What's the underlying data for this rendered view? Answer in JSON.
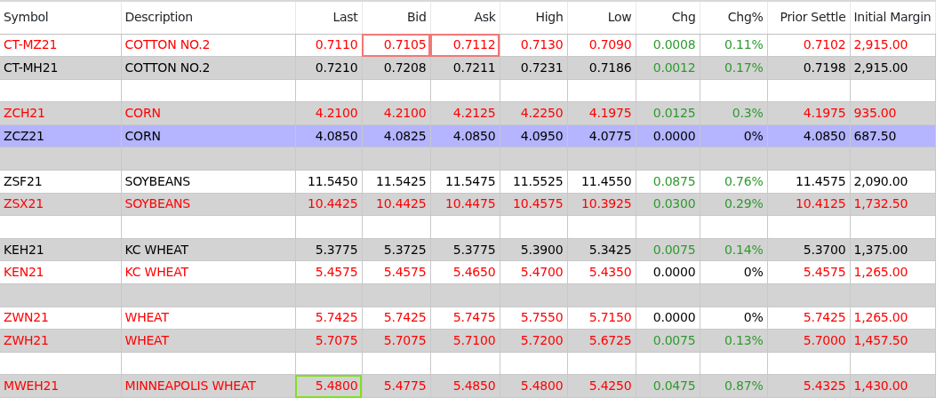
{
  "table": {
    "columns": [
      "Symbol",
      "Description",
      "Last",
      "Bid",
      "Ask",
      "High",
      "Low",
      "Chg",
      "Chg%",
      "Prior Settle",
      "Initial Margin"
    ],
    "rows": [
      {
        "kind": "quote",
        "shaded": false,
        "selected": false,
        "color": "#ff0000",
        "changed": true,
        "cells": [
          "CT-MZ21",
          "COTTON NO.2",
          "0.7110",
          {
            "text": "0.7105",
            "highlighted": true,
            "uptick": false
          },
          {
            "text": "0.7112",
            "highlighted": true,
            "uptick": false
          },
          "0.7130",
          "0.7090",
          "0.0008",
          "0.11%",
          "0.7102",
          "2,915.00"
        ]
      },
      {
        "kind": "quote",
        "shaded": true,
        "selected": false,
        "color": "#000000",
        "changed": true,
        "cells": [
          "CT-MH21",
          "COTTON NO.2",
          "0.7210",
          "0.7208",
          "0.7211",
          "0.7231",
          "0.7186",
          "0.0012",
          "0.17%",
          "0.7198",
          "2,915.00"
        ]
      },
      {
        "kind": "blank",
        "shaded": false,
        "selected": false
      },
      {
        "kind": "quote",
        "shaded": true,
        "selected": false,
        "color": "#ff0000",
        "changed": true,
        "cells": [
          "ZCH21",
          "CORN",
          "4.2100",
          "4.2100",
          "4.2125",
          "4.2250",
          "4.1975",
          "0.0125",
          "0.3%",
          "4.1975",
          "935.00"
        ]
      },
      {
        "kind": "quote",
        "selected": true,
        "color": "#000000",
        "changed": false,
        "cells": [
          "ZCZ21",
          "CORN",
          "4.0850",
          "4.0825",
          "4.0850",
          "4.0950",
          "4.0775",
          "0.0000",
          "0%",
          "4.0850",
          "687.50"
        ]
      },
      {
        "kind": "blank",
        "shaded": true,
        "selected": false
      },
      {
        "kind": "quote",
        "shaded": false,
        "selected": false,
        "color": "#000000",
        "changed": true,
        "cells": [
          "ZSF21",
          "SOYBEANS",
          "11.5450",
          "11.5425",
          "11.5475",
          "11.5525",
          "11.4550",
          "0.0875",
          "0.76%",
          "11.4575",
          "2,090.00"
        ]
      },
      {
        "kind": "quote",
        "shaded": true,
        "selected": false,
        "color": "#ff0000",
        "changed": true,
        "cells": [
          "ZSX21",
          "SOYBEANS",
          "10.4425",
          "10.4425",
          "10.4475",
          "10.4575",
          "10.3925",
          "0.0300",
          "0.29%",
          "10.4125",
          "1,732.50"
        ]
      },
      {
        "kind": "blank",
        "shaded": false,
        "selected": false
      },
      {
        "kind": "quote",
        "shaded": true,
        "selected": false,
        "color": "#000000",
        "changed": true,
        "cells": [
          "KEH21",
          "KC WHEAT",
          "5.3775",
          "5.3725",
          "5.3775",
          "5.3900",
          "5.3425",
          "0.0075",
          "0.14%",
          "5.3700",
          "1,375.00"
        ]
      },
      {
        "kind": "quote",
        "shaded": false,
        "selected": false,
        "color": "#ff0000",
        "changed": false,
        "cells": [
          "KEN21",
          "KC WHEAT",
          "5.4575",
          "5.4575",
          "5.4650",
          "5.4700",
          "5.4350",
          "0.0000",
          "0%",
          "5.4575",
          "1,265.00"
        ]
      },
      {
        "kind": "blank",
        "shaded": true,
        "selected": false
      },
      {
        "kind": "quote",
        "shaded": false,
        "selected": false,
        "color": "#ff0000",
        "changed": false,
        "cells": [
          "ZWN21",
          "WHEAT",
          "5.7425",
          "5.7425",
          "5.7475",
          "5.7550",
          "5.7150",
          "0.0000",
          "0%",
          "5.7425",
          "1,265.00"
        ]
      },
      {
        "kind": "quote",
        "shaded": true,
        "selected": false,
        "color": "#ff0000",
        "changed": true,
        "cells": [
          "ZWH21",
          "WHEAT",
          "5.7075",
          "5.7075",
          "5.7100",
          "5.7200",
          "5.6725",
          "0.0075",
          "0.13%",
          "5.7000",
          "1,457.50"
        ]
      },
      {
        "kind": "blank",
        "shaded": false,
        "selected": false
      },
      {
        "kind": "quote",
        "shaded": true,
        "selected": false,
        "color": "#ff0000",
        "changed": true,
        "cells": [
          "MWEH21",
          "MINNEAPOLIS WHEAT",
          {
            "text": "5.4800",
            "highlighted": true,
            "uptick": true
          },
          "5.4775",
          "5.4850",
          "5.4800",
          "5.4250",
          "0.0475",
          "0.87%",
          "5.4325",
          "1,430.00"
        ]
      }
    ]
  }
}
